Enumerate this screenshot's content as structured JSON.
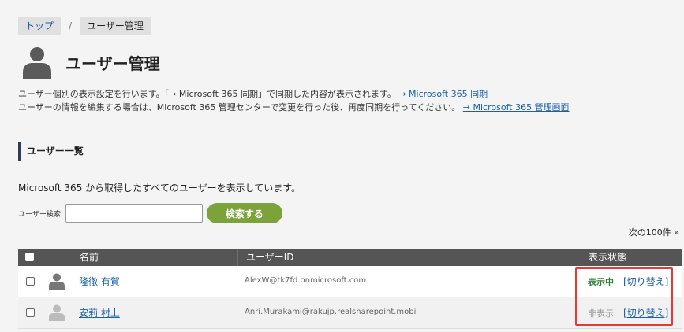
{
  "breadcrumb": {
    "home": "トップ",
    "separator": "/",
    "current": "ユーザー管理"
  },
  "page_title": "ユーザー管理",
  "description": {
    "line1": "ユーザー個別の表示設定を行います。「→ Microsoft 365 同期」で同期した内容が表示されます。",
    "line1_link": "→ Microsoft 365 同期",
    "line2": "ユーザーの情報を編集する場合は、Microsoft 365 管理センターで変更を行った後、再度同期を行ってください。",
    "line2_link": "→ Microsoft 365 管理画面"
  },
  "section_title": "ユーザー一覧",
  "list_description": "Microsoft 365 から取得したすべてのユーザーを表示しています。",
  "search": {
    "label": "ユーザー検索:",
    "value": "",
    "placeholder": "",
    "button": "検索する"
  },
  "next_page": "次の100件 »",
  "table": {
    "headers": {
      "name": "名前",
      "user_id": "ユーザーID",
      "status": "表示状態"
    },
    "rows": [
      {
        "name": "隆徹 有賀",
        "user_id": "AlexW@tk7fd.onmicrosoft.com",
        "status": "表示中",
        "toggle": "[切り替え]"
      },
      {
        "name": "安莉 村上",
        "user_id": "Anri.Murakami@rakujp.realsharepoint.mobi",
        "status": "非表示",
        "toggle": "[切り替え]"
      }
    ]
  },
  "colors": {
    "accent_green": "#7ba33a",
    "status_green": "#2e7d32",
    "link_blue": "#1a5fa8",
    "highlight_red": "#e53935",
    "header_dark": "#555555"
  },
  "icons": {
    "page": "user-silhouette-icon",
    "avatar": "user-avatar-icon"
  }
}
